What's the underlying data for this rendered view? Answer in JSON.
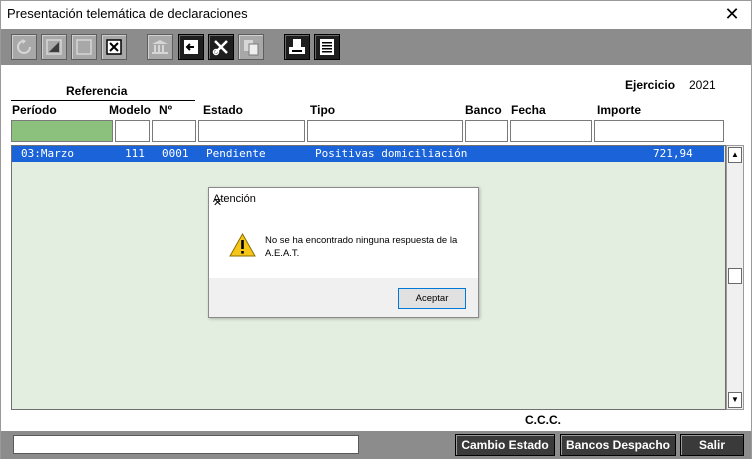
{
  "window": {
    "title": "Presentación telemática de declaraciones",
    "close_glyph": "✕"
  },
  "toolbar": {
    "buttons": [
      {
        "icon": "refresh-icon",
        "state": "disabled"
      },
      {
        "icon": "edit-icon",
        "state": "disabled"
      },
      {
        "icon": "blank-icon",
        "state": "disabled"
      },
      {
        "icon": "delete-icon",
        "state": "enabled"
      },
      {
        "icon": "bank-icon",
        "state": "disabled"
      },
      {
        "icon": "exit-icon",
        "state": "active"
      },
      {
        "icon": "cut-icon",
        "state": "active"
      },
      {
        "icon": "copy-icon",
        "state": "disabled"
      },
      {
        "icon": "print-icon",
        "state": "active"
      },
      {
        "icon": "list-icon",
        "state": "active"
      }
    ]
  },
  "form": {
    "ejercicio_label": "Ejercicio",
    "ejercicio_value": "2021",
    "referencia_label": "Referencia",
    "columns": {
      "periodo": "Período",
      "modelo": "Modelo",
      "numero": "Nº",
      "estado": "Estado",
      "tipo": "Tipo",
      "banco": "Banco",
      "fecha": "Fecha",
      "importe": "Importe"
    },
    "filters": {
      "periodo": "",
      "modelo": "",
      "numero": "",
      "estado": "",
      "tipo": "",
      "banco": "",
      "fecha": "",
      "importe": ""
    }
  },
  "grid": {
    "rows": [
      {
        "periodo": "03:Marzo",
        "modelo": "111",
        "numero": "0001",
        "estado": "Pendiente",
        "tipo": "Positivas domiciliación",
        "banco": "",
        "fecha": "",
        "importe": "721,94",
        "selected": true
      }
    ],
    "selection_color": "#1a63d8",
    "background_color": "#e3eee0"
  },
  "ccc_label": "C.C.C.",
  "bottom": {
    "input_value": "",
    "buttons": {
      "cambio_estado": "Cambio Estado",
      "bancos_despacho": "Bancos Despacho",
      "salir": "Salir"
    }
  },
  "dialog": {
    "title": "Atención",
    "close_glyph": "✕",
    "icon": "warning-icon",
    "message": "No se ha encontrado ninguna respuesta de la A.E.A.T.",
    "ok_label": "Aceptar"
  }
}
